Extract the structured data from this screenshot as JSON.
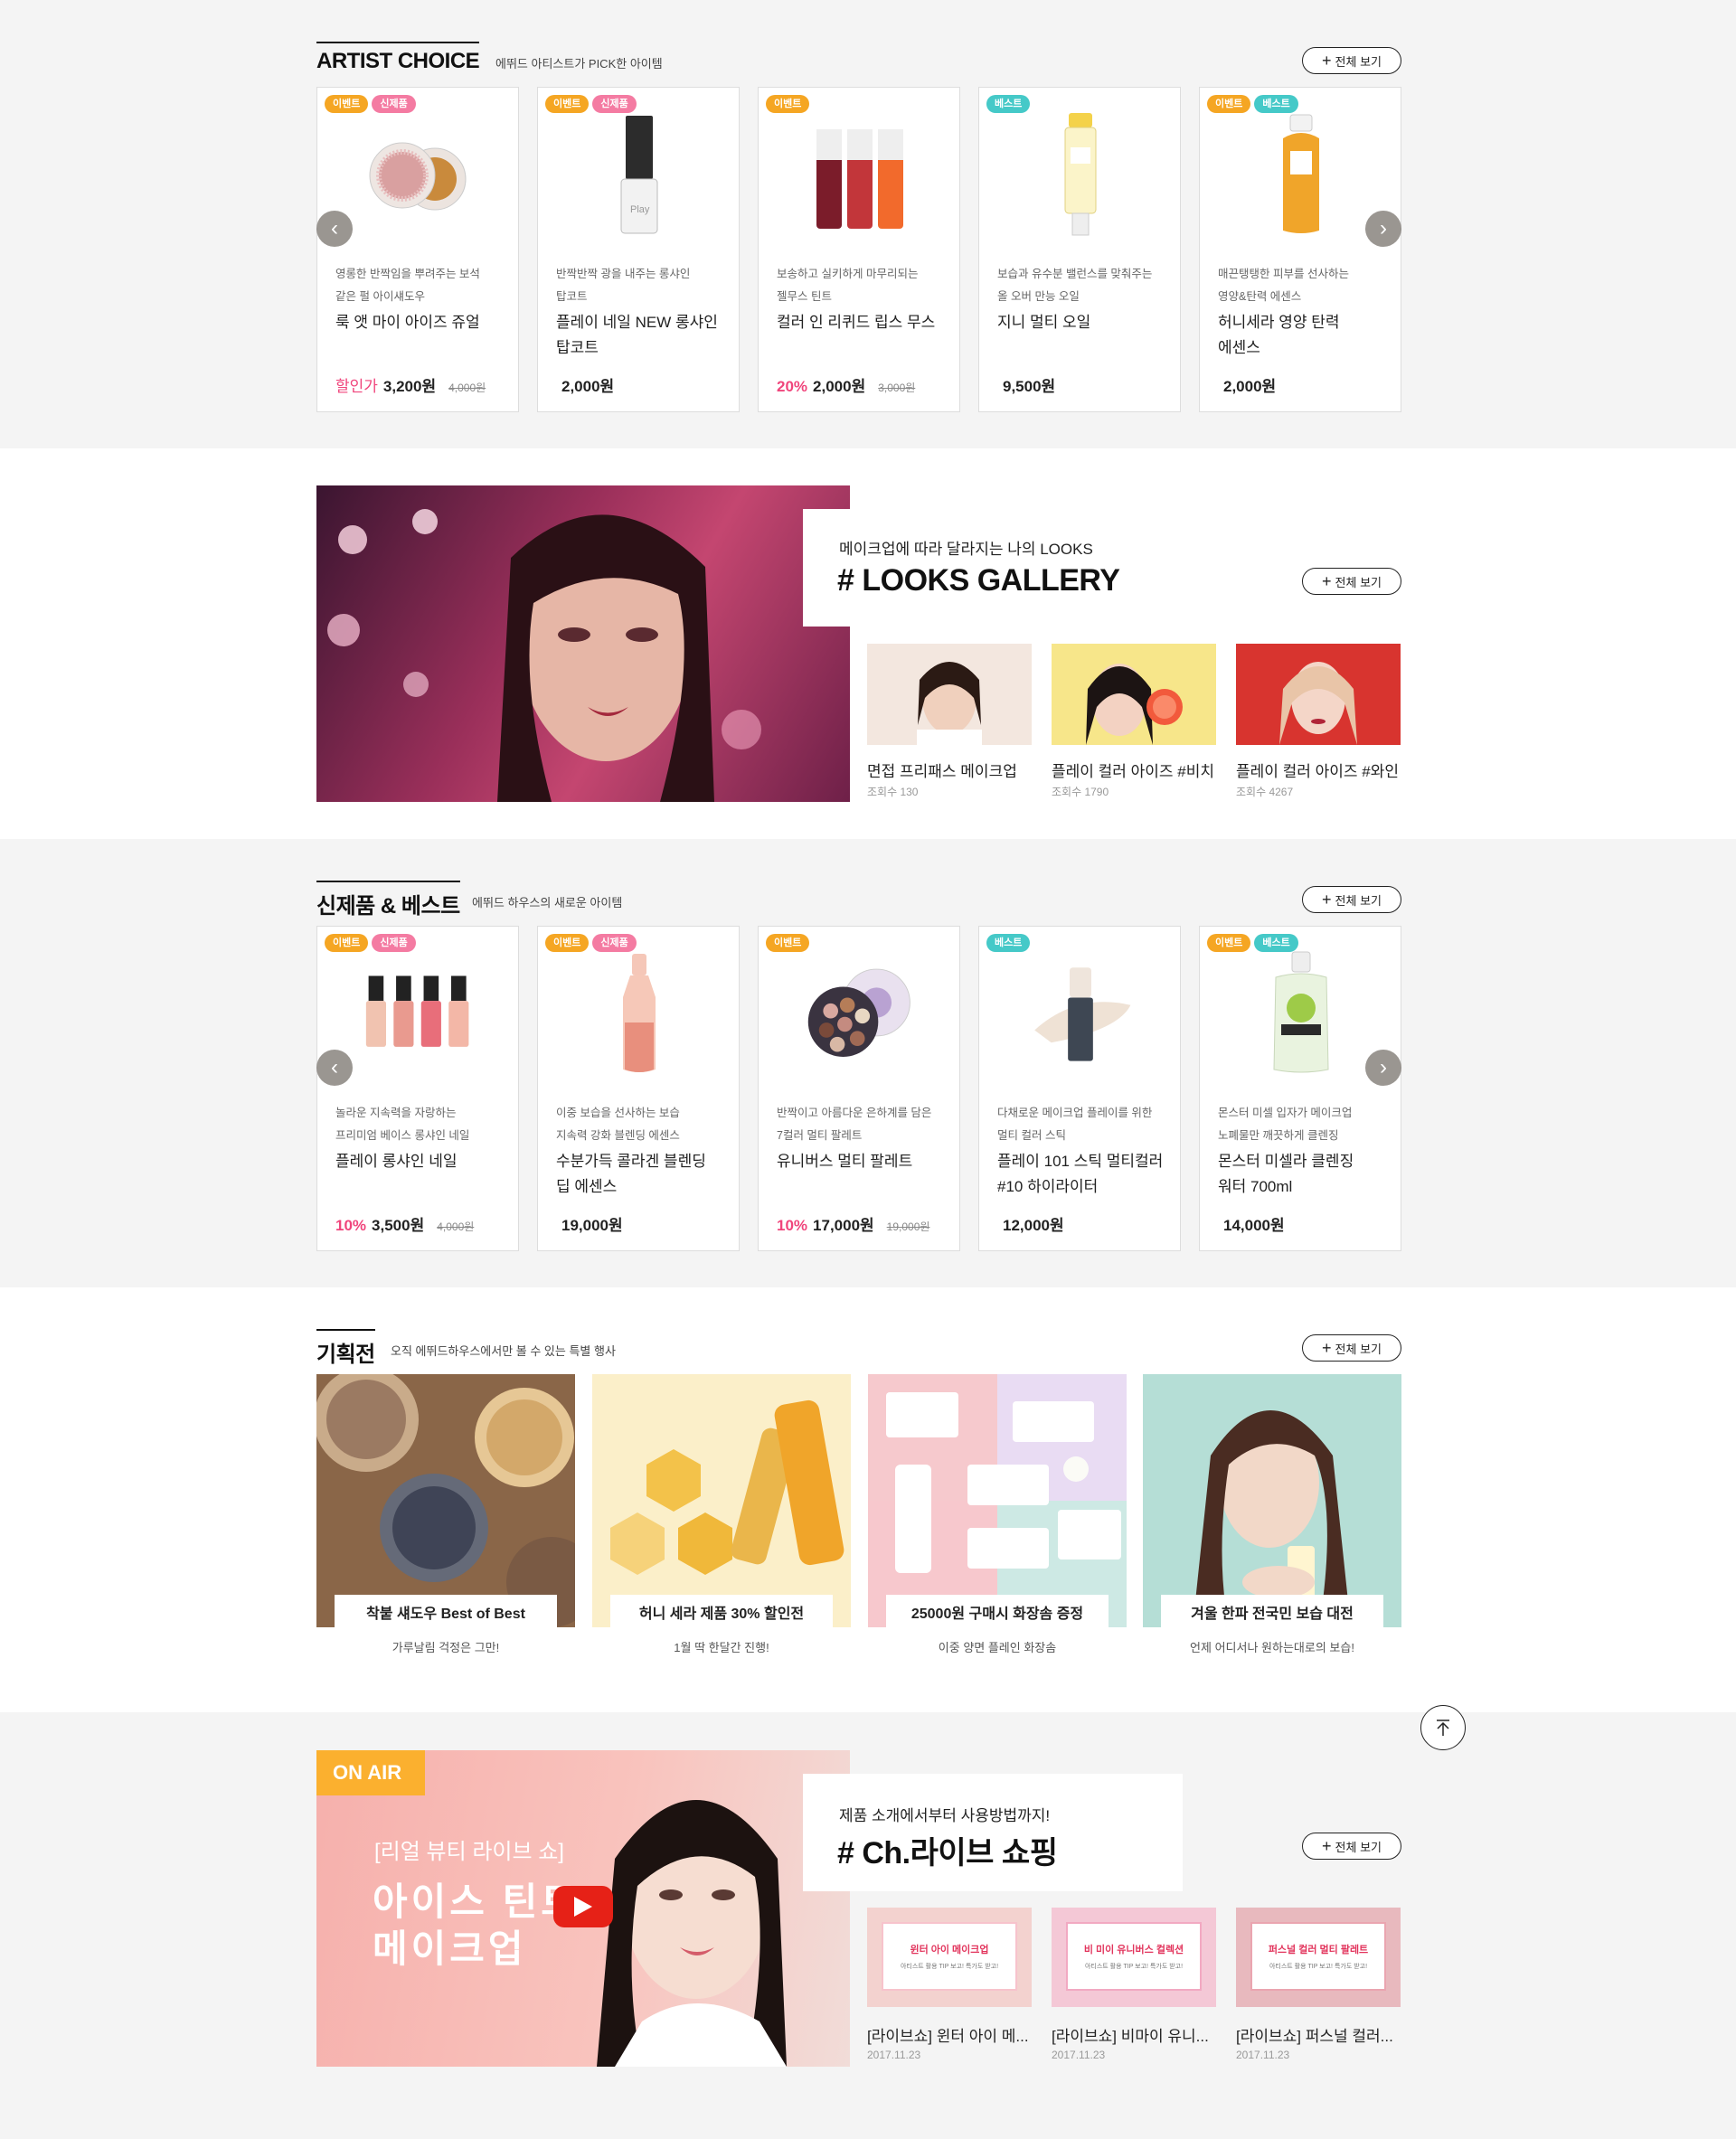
{
  "artist_choice": {
    "title": "ARTIST CHOICE",
    "subtitle": "에뛰드 아티스트가 PICK한 아이템",
    "view_all": "전체 보기",
    "products": [
      {
        "badges": [
          "이벤트",
          "신제품"
        ],
        "desc1": "영롱한 반짝임을 뿌려주는 보석",
        "desc2": "같은 펄 아이섀도우",
        "name1": "룩 앳 마이 아이즈 쥬얼",
        "name2": "",
        "discount": "할인가",
        "price": "3,200원",
        "original": "4,000원"
      },
      {
        "badges": [
          "이벤트",
          "신제품"
        ],
        "desc1": "반짝반짝 광을 내주는 롱샤인",
        "desc2": "탑코트",
        "name1": "플레이 네일 NEW 롱샤인",
        "name2": "탑코트",
        "discount": "",
        "price": "2,000원",
        "original": ""
      },
      {
        "badges": [
          "이벤트"
        ],
        "desc1": "보송하고 실키하게 마무리되는",
        "desc2": "젤무스 틴트",
        "name1": "컬러 인 리퀴드 립스 무스",
        "name2": "",
        "discount": "20%",
        "price": "2,000원",
        "original": "3,000원"
      },
      {
        "badges": [
          "베스트"
        ],
        "desc1": "보습과 유수분 밸런스를 맞춰주는",
        "desc2": "올 오버 만능 오일",
        "name1": "지니 멀티 오일",
        "name2": "",
        "discount": "",
        "price": "9,500원",
        "original": ""
      },
      {
        "badges": [
          "이벤트",
          "베스트"
        ],
        "desc1": "매끈탱탱한 피부를 선사하는",
        "desc2": "영양&탄력 에센스",
        "name1": "허니세라 영양 탄력",
        "name2": "에센스",
        "discount": "",
        "price": "2,000원",
        "original": ""
      }
    ]
  },
  "looks": {
    "subtitle": "메이크업에 따라 달라지는 나의 LOOKS",
    "title": "# LOOKS GALLERY",
    "view_all": "전체 보기",
    "items": [
      {
        "title": "면접 프리패스 메이크업",
        "views": "조회수 130"
      },
      {
        "title": "플레이 컬러 아이즈 #비치",
        "views": "조회수 1790"
      },
      {
        "title": "플레이 컬러 아이즈 #와인",
        "views": "조회수 4267"
      }
    ]
  },
  "new_best": {
    "title": "신제품 & 베스트",
    "subtitle": "에뛰드 하우스의 새로운 아이템",
    "view_all": "전체 보기",
    "products": [
      {
        "badges": [
          "이벤트",
          "신제품"
        ],
        "desc1": "놀라운 지속력을 자랑하는",
        "desc2": "프리미엄 베이스 롱샤인 네일",
        "name1": "플레이 롱샤인 네일",
        "name2": "",
        "discount": "10%",
        "price": "3,500원",
        "original": "4,000원"
      },
      {
        "badges": [
          "이벤트",
          "신제품"
        ],
        "desc1": "이중 보습을 선사하는 보습",
        "desc2": "지속력 강화 블렌딩 에센스",
        "name1": "수분가득 콜라겐 블렌딩",
        "name2": "딥 에센스",
        "discount": "",
        "price": "19,000원",
        "original": ""
      },
      {
        "badges": [
          "이벤트"
        ],
        "desc1": "반짝이고 아름다운 은하계를 담은",
        "desc2": "7컬러 멀티 팔레트",
        "name1": "유니버스 멀티 팔레트",
        "name2": "",
        "discount": "10%",
        "price": "17,000원",
        "original": "19,000원"
      },
      {
        "badges": [
          "베스트"
        ],
        "desc1": "다채로운 메이크업 플레이를 위한",
        "desc2": "멀티 컬러 스틱",
        "name1": "플레이 101 스틱 멀티컬러",
        "name2": "#10 하이라이터",
        "discount": "",
        "price": "12,000원",
        "original": ""
      },
      {
        "badges": [
          "이벤트",
          "베스트"
        ],
        "desc1": "몬스터 미셀 입자가 메이크업",
        "desc2": "노폐물만 깨끗하게 클렌징",
        "name1": "몬스터 미셀라 클렌징",
        "name2": "워터 700ml",
        "discount": "",
        "price": "14,000원",
        "original": ""
      }
    ]
  },
  "special": {
    "title": "기획전",
    "subtitle": "오직 에뛰드하우스에서만 볼 수 있는 특별 행사",
    "view_all": "전체 보기",
    "items": [
      {
        "label": "착붙 섀도우 Best of Best",
        "sub": "가루날림 걱정은 그만!"
      },
      {
        "label": "허니 세라 제품 30% 할인전",
        "sub": "1월 딱 한달간 진행!"
      },
      {
        "label": "25000원 구매시 화장솜 증정",
        "sub": "이중 양면 플레인 화장솜"
      },
      {
        "label": "겨울 한파 전국민 보습 대전",
        "sub": "언제 어디서나 원하는대로의 보습!"
      }
    ]
  },
  "live": {
    "badge": "ON AIR",
    "hero_line1": "[리얼 뷰티 라이브 쇼]",
    "hero_line2": "아이스 틴트",
    "hero_line3": "메이크업",
    "subtitle": "제품 소개에서부터 사용방법까지!",
    "title": "# Ch.라이브 쇼핑",
    "view_all": "전체 보기",
    "items": [
      {
        "thumb_title": "윈터 아이 메이크업",
        "thumb_sub": "아티스트 활용 TIP 보고! 특가도 받고!",
        "title": "[라이브쇼] 윈터 아이 메...",
        "date": "2017.11.23"
      },
      {
        "thumb_title": "비 미이 유니버스 컬렉션",
        "thumb_sub": "아티스트 활용 TIP 보고! 특가도 받고!",
        "title": "[라이브쇼] 비마이 유니...",
        "date": "2017.11.23"
      },
      {
        "thumb_title": "퍼스널 컬러 멀티 팔레트",
        "thumb_sub": "아티스트 활용 TIP 보고! 특가도 받고!",
        "title": "[라이브쇼] 퍼스널 컬러...",
        "date": "2017.11.23"
      }
    ]
  },
  "icons": [
    "plus-icon",
    "chevron-left-icon",
    "chevron-right-icon",
    "play-icon",
    "arrow-up-icon"
  ]
}
